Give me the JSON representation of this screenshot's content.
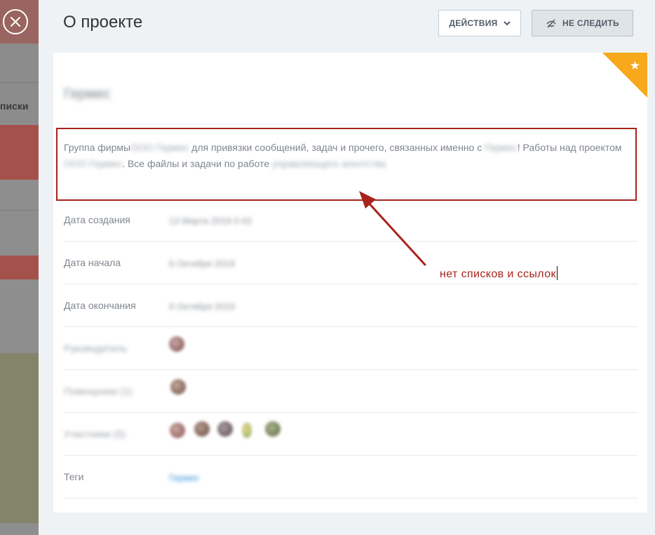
{
  "backdrop": {
    "label": "писки"
  },
  "header": {
    "title": "О проекте",
    "actions_label": "ДЕЙСТВИЯ",
    "follow_label": "НЕ СЛЕДИТЬ"
  },
  "project": {
    "name": "Гермес",
    "favorite": true,
    "description": {
      "t1": "Группа фирмы",
      "b1": "ООО Гермес",
      "t2": " для привязки сообщений, задач и прочего, связанных именно с ",
      "b2": "Гермес",
      "t3": "! Работы над проектом ",
      "b3": "ООО Гермес",
      "t4": ". Все файлы и задачи по работе ",
      "b4": "управляющего агентства"
    }
  },
  "details": {
    "created_label": "Дата создания",
    "created_value": "13 Марта 2019 0:43",
    "start_label": "Дата начала",
    "start_value": "6 Октября 2019",
    "end_label": "Дата окончания",
    "end_value": "6 Октября 2019",
    "owner_label": "Руководитель",
    "deputies_label": "Помощники (1)",
    "members_label": "Участники (5)",
    "tags_label": "Теги",
    "tags_value": "Гермес"
  },
  "annotation": {
    "text": "нет списков и ссылок",
    "color": "#a8231c"
  },
  "colors": {
    "accent_orange": "#f7a81b",
    "link_blue": "#2d8dd6",
    "text_gray": "#80868e"
  }
}
